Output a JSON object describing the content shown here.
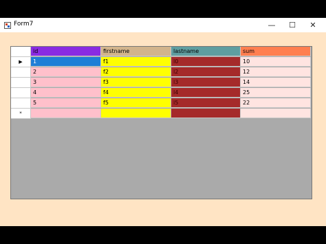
{
  "window": {
    "title": "Form7",
    "minimize_glyph": "—",
    "maximize_glyph": "☐",
    "close_glyph": "✕"
  },
  "grid": {
    "columns": [
      {
        "label": "id",
        "color": "#8a2be2"
      },
      {
        "label": "firstname",
        "color": "#d2b48c"
      },
      {
        "label": "lastname",
        "color": "#5f9ea0"
      },
      {
        "label": "sum",
        "color": "#ff7f50"
      }
    ],
    "rows": [
      {
        "marker": "▶",
        "id": "1",
        "firstname": "f1",
        "lastname": "l0",
        "sum": "10"
      },
      {
        "marker": "",
        "id": "2",
        "firstname": "f2",
        "lastname": "l2",
        "sum": "12"
      },
      {
        "marker": "",
        "id": "3",
        "firstname": "f3",
        "lastname": "l3",
        "sum": "14"
      },
      {
        "marker": "",
        "id": "4",
        "firstname": "f4",
        "lastname": "l4",
        "sum": "25"
      },
      {
        "marker": "",
        "id": "5",
        "firstname": "f5",
        "lastname": "l5",
        "sum": "22"
      }
    ],
    "new_row_marker": "*",
    "colors": {
      "id_cell": "#ffc0cb",
      "id_selected": "#1e7fd6",
      "firstname_cell": "#ffff00",
      "lastname_cell": "#a52a2a",
      "sum_cell": "#ffe4e1"
    }
  }
}
